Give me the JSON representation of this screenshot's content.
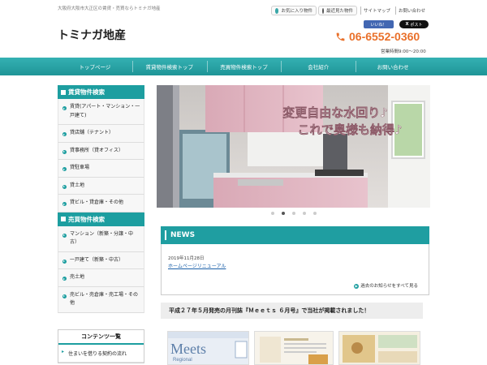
{
  "header": {
    "tagline": "大阪府大阪市大正区の賃貸・売買ならトミナガ地産",
    "favorites_label": "お気に入り物件",
    "recent_label": "最近見た物件",
    "sitemap_label": "サイトマップ",
    "contact_label": "お問い合わせ",
    "logo_text": "トミナガ地産",
    "fb_like_label": "いいね！",
    "x_post_label": "ポスト",
    "phone": "06-6552-0360",
    "hours": "営業時間9:00～20:00"
  },
  "nav": {
    "items": [
      {
        "label": "トップページ"
      },
      {
        "label": "賃貸物件検索トップ"
      },
      {
        "label": "売買物件検索トップ"
      },
      {
        "label": "会社紹介"
      },
      {
        "label": "お問い合わせ"
      }
    ]
  },
  "sidebar": {
    "rent_title": "賃貸物件検索",
    "rent_items": [
      {
        "label": "賃貸(アパート・マンション・一戸建て)"
      },
      {
        "label": "貸店舗（テナント）"
      },
      {
        "label": "貸事務所（貸オフィス）"
      },
      {
        "label": "貸駐車場"
      },
      {
        "label": "貸土地"
      },
      {
        "label": "貸ビル・貸倉庫・その他"
      }
    ],
    "sale_title": "売買物件検索",
    "sale_items": [
      {
        "label": "マンション（新築・分譲・中古）"
      },
      {
        "label": "一戸建て（新築・中古）"
      },
      {
        "label": "売土地"
      },
      {
        "label": "売ビル・売倉庫・売工場・その他"
      }
    ],
    "contents_title": "コンテンツ一覧",
    "contents_items": [
      {
        "label": "住まいを借りる契約の流れ"
      }
    ]
  },
  "slider": {
    "caption_line1": "変更自由な水回り♪",
    "caption_line2": "これで奥様も納得♪",
    "dots_total": 5,
    "active_index": 1
  },
  "news": {
    "title": "NEWS",
    "date": "2019年11月28日",
    "link_text": "ホームページリニューアル",
    "more_label": "過去のお知らせをすべて見る"
  },
  "feature": {
    "headline": "平成２７年５月発売の月刊誌『Ｍｅｅｔｓ ６月号』で当社が掲載されました！",
    "magazine_title": "Meets",
    "magazine_subtitle": "Regional"
  },
  "colors": {
    "teal": "#1d9ea0",
    "orange": "#e9702a",
    "facebook": "#4267b2"
  }
}
